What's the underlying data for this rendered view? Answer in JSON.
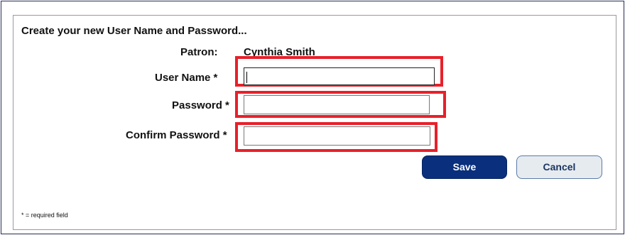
{
  "form": {
    "heading": "Create your new User Name and Password...",
    "patron_label": "Patron:",
    "patron_name": "Cynthia Smith",
    "username_label": "User Name *",
    "username_value": "",
    "password_label": "Password *",
    "password_value": "",
    "confirm_label": "Confirm Password *",
    "confirm_value": "",
    "save_label": "Save",
    "cancel_label": "Cancel",
    "footnote": "* = required field"
  },
  "colors": {
    "highlight_border": "#e8202a",
    "save_button_bg": "#0a2f7d",
    "cancel_button_bg": "#e6ebf0",
    "frame_border": "#2b2f55"
  }
}
